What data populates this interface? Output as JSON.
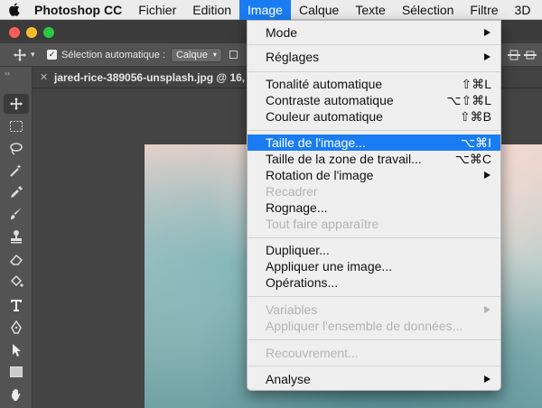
{
  "menubar": {
    "app": "Photoshop CC",
    "items": [
      "Fichier",
      "Edition",
      "Image",
      "Calque",
      "Texte",
      "Sélection",
      "Filtre",
      "3D"
    ],
    "active": "Image"
  },
  "options": {
    "checkbox_label": "Sélection automatique :",
    "select_value": "Calque"
  },
  "document": {
    "tab_title": "jared-rice-389056-unsplash.jpg @ 16,"
  },
  "menu": {
    "items": [
      {
        "label": "Mode",
        "submenu": true
      },
      {
        "label": "Réglages",
        "submenu": true
      },
      {
        "label": "Tonalité automatique",
        "shortcut": "⇧⌘L"
      },
      {
        "label": "Contraste automatique",
        "shortcut": "⌥⇧⌘L"
      },
      {
        "label": "Couleur automatique",
        "shortcut": "⇧⌘B"
      },
      {
        "label": "Taille de l'image...",
        "shortcut": "⌥⌘I",
        "highlighted": true
      },
      {
        "label": "Taille de la zone de travail...",
        "shortcut": "⌥⌘C"
      },
      {
        "label": "Rotation de l'image",
        "submenu": true
      },
      {
        "label": "Recadrer",
        "disabled": true
      },
      {
        "label": "Rognage..."
      },
      {
        "label": "Tout faire apparaître",
        "disabled": true
      },
      {
        "label": "Dupliquer..."
      },
      {
        "label": "Appliquer une image..."
      },
      {
        "label": "Opérations..."
      },
      {
        "label": "Variables",
        "disabled": true,
        "submenu": true
      },
      {
        "label": "Appliquer l'ensemble de données...",
        "disabled": true
      },
      {
        "label": "Recouvrement...",
        "disabled": true
      },
      {
        "label": "Analyse",
        "submenu": true
      }
    ]
  },
  "colors": {
    "highlight": "#1a7cf3",
    "traffic_red": "#fc5f57",
    "traffic_yellow": "#fdbc2e",
    "traffic_green": "#28c840"
  }
}
